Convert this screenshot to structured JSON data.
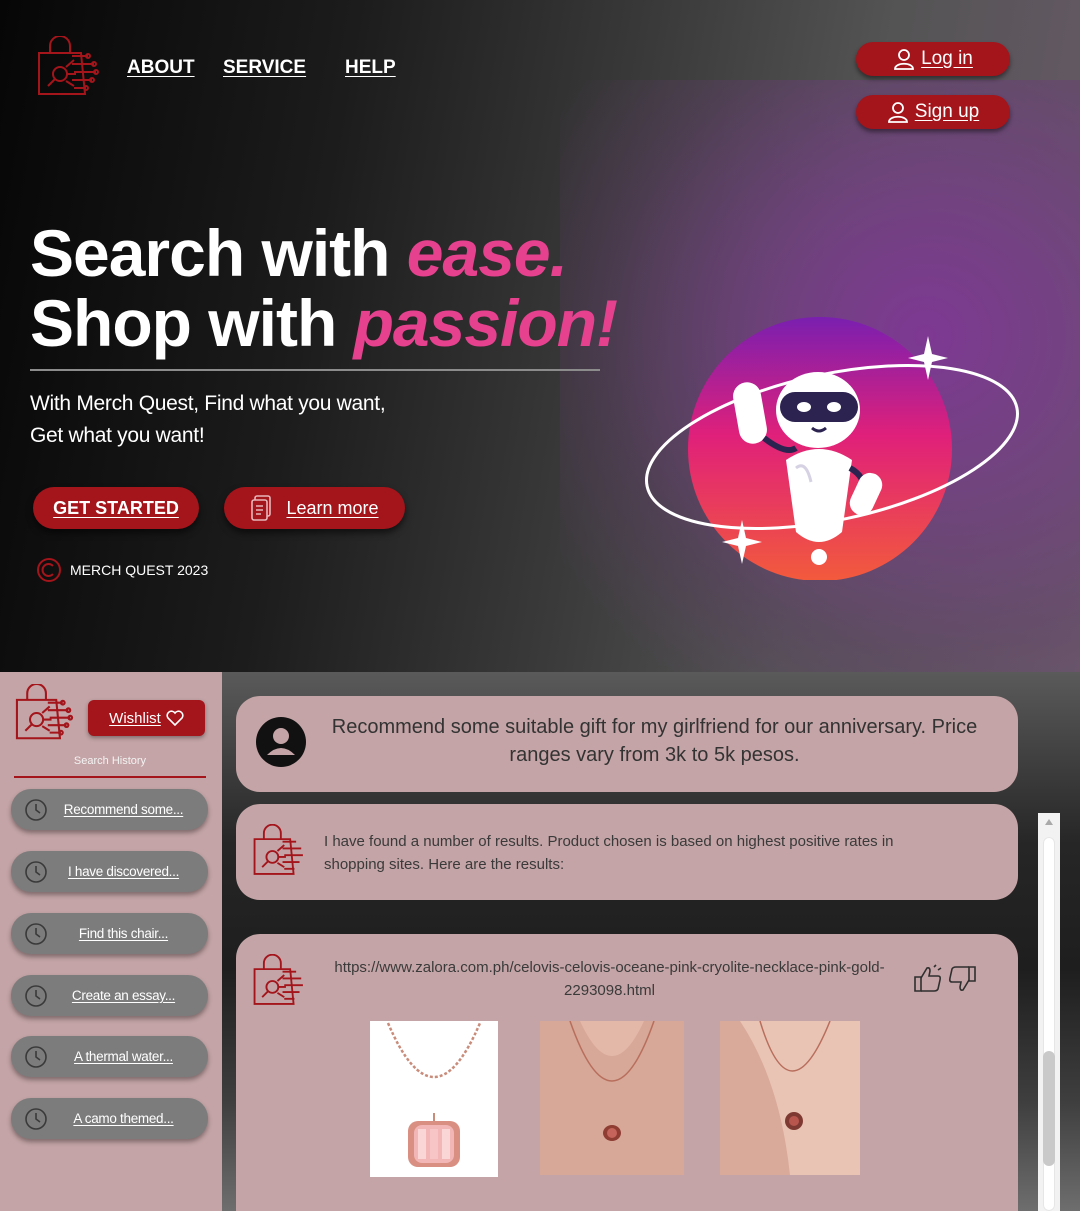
{
  "hero": {
    "nav": {
      "about": "ABOUT",
      "service": "SERVICE",
      "help": "HELP"
    },
    "auth": {
      "login": "Log in",
      "signup": "Sign up"
    },
    "headline": {
      "line1_plain": "Search with ",
      "line1_accent": "ease.",
      "line2_plain": "Shop with ",
      "line2_accent": "passion!"
    },
    "subtitle": {
      "line1": "With Merch Quest, Find what you want,",
      "line2": "Get what you want!"
    },
    "buttons": {
      "get_started": "GET STARTED",
      "learn_more": "Learn more"
    },
    "copyright": "MERCH QUEST 2023"
  },
  "sidebar": {
    "wishlist": "Wishlist",
    "history_title": "Search History",
    "history": [
      "Recommend some...",
      "I have discovered...",
      "Find this chair...",
      "Create an essay...",
      "A thermal water...",
      "A camo themed..."
    ]
  },
  "chat": {
    "user_message": "Recommend some suitable gift for my girlfriend for our anniversary.  Price ranges vary from 3k to 5k pesos.",
    "bot_message": "I have found a number of results. Product chosen is based on highest positive rates in shopping sites. Here are the results:",
    "result_url": "https://www.zalora.com.ph/celovis-celovis-oceane-pink-cryolite-necklace-pink-gold-2293098.html"
  },
  "colors": {
    "brand_red": "#a3141b",
    "accent_pink": "#e6418f",
    "panel_rose": "#c4a4a6"
  },
  "icons": [
    "shopping-bag-logo-icon",
    "user-icon",
    "document-icon",
    "copyright-icon",
    "robot-mascot-icon",
    "heart-icon",
    "clock-icon",
    "user-avatar-icon",
    "thumbs-up-icon",
    "thumbs-down-icon"
  ]
}
